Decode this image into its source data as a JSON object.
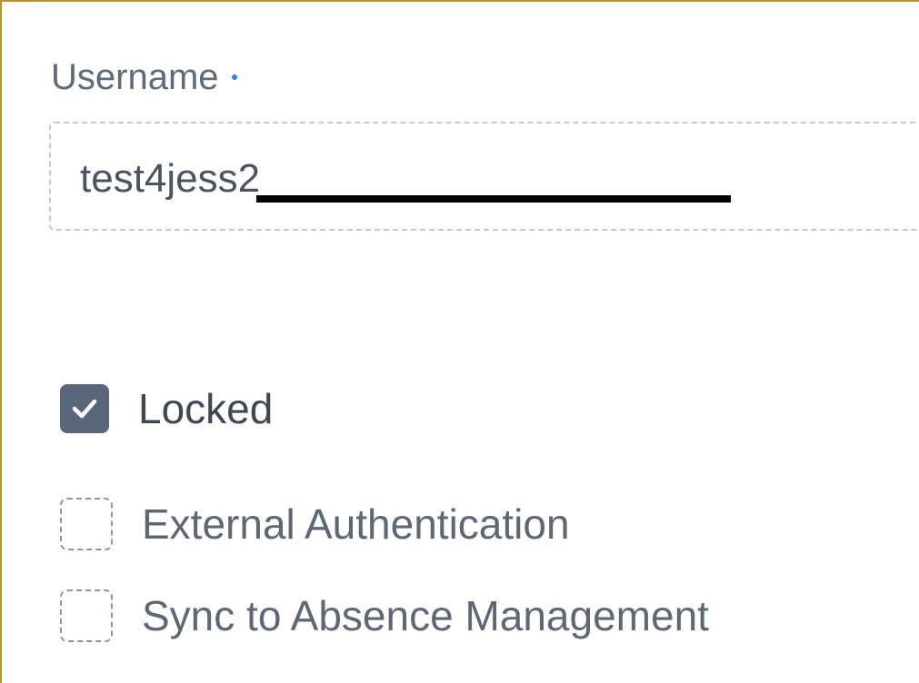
{
  "colors": {
    "frame_border": "#b8962e",
    "required_dot": "#2f80ed",
    "checkbox_checked": "#5a6679",
    "checkmark": "#ffffff"
  },
  "username": {
    "label": "Username",
    "required": true,
    "value": "test4jess2"
  },
  "options": [
    {
      "label": "Locked",
      "checked": true,
      "icon": "check-icon"
    },
    {
      "label": "External Authentication",
      "checked": false
    },
    {
      "label": "Sync to Absence Management",
      "checked": false
    }
  ]
}
